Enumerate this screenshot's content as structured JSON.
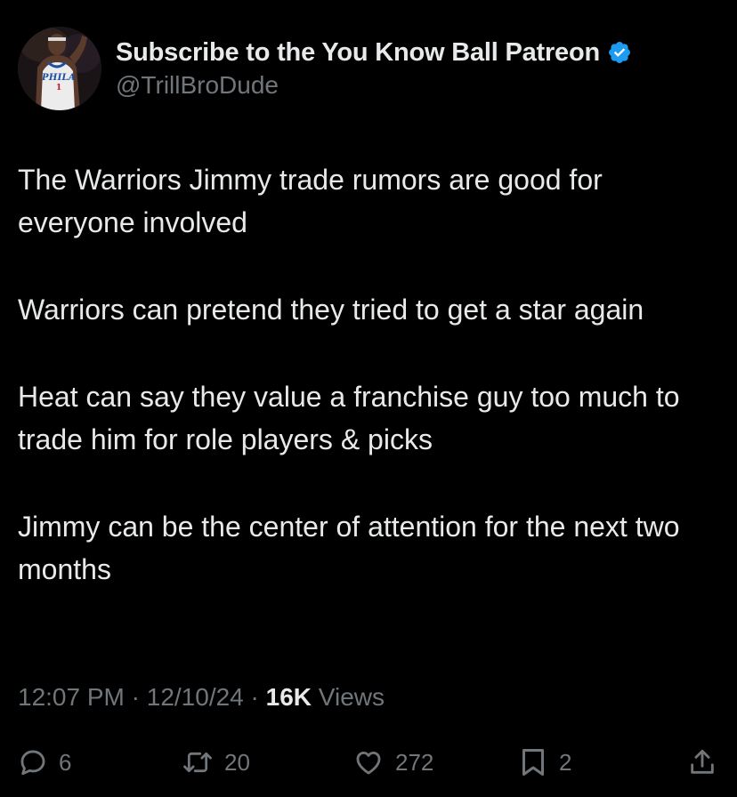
{
  "tweet": {
    "display_name": "Subscribe to the You Know Ball Patreon",
    "handle": "@TrillBroDude",
    "avatar": {
      "icon": "player-avatar",
      "jersey_text": "PHILA",
      "jersey_number": "1"
    },
    "verified_icon": "verified-badge-icon",
    "paragraphs": [
      "The Warriors Jimmy trade rumors are good for everyone involved",
      "Warriors can pretend they tried to get a star again",
      "Heat can say they value a franchise guy too much to trade him for role players & picks",
      "Jimmy can be the center of attention for the next two months"
    ],
    "time": "12:07 PM",
    "separator": "·",
    "date": "12/10/24",
    "views_count": "16K",
    "views_label": "Views"
  },
  "actions": {
    "reply": {
      "icon": "reply-icon",
      "count": "6"
    },
    "repost": {
      "icon": "repost-icon",
      "count": "20"
    },
    "like": {
      "icon": "heart-icon",
      "count": "272"
    },
    "bookmark": {
      "icon": "bookmark-icon",
      "count": "2"
    },
    "share": {
      "icon": "share-icon"
    }
  },
  "colors": {
    "background": "#000000",
    "primary_text": "#e7e9ea",
    "secondary_text": "#71767b",
    "verified_blue": "#1d9bf0"
  }
}
